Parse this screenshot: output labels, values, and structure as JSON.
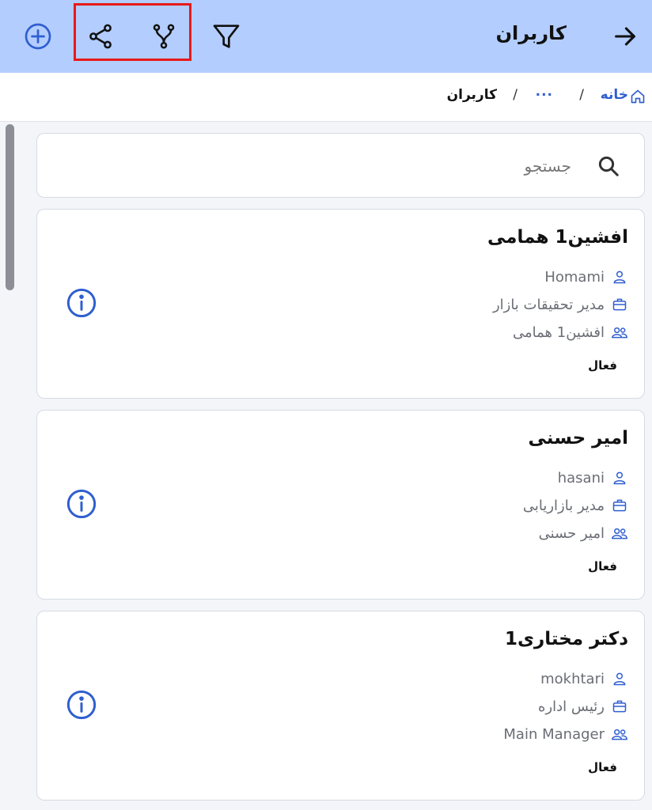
{
  "header": {
    "title": "کاربران",
    "back_icon": "arrow-right-icon",
    "filter_icon": "filter-icon",
    "fork_icon": "fork-icon",
    "share_icon": "share-icon",
    "add_icon": "plus-circle-icon",
    "bg_color": "#b3cdfe",
    "highlight_color": "#e8191a"
  },
  "breadcrumb": {
    "home": "خانه",
    "separator": "/",
    "more": "...",
    "current": "کاربران"
  },
  "search": {
    "placeholder": "جستجو"
  },
  "users": [
    {
      "name": "افشین1 همامی",
      "username": "Homami",
      "job_title": "مدیر تحقیقات بازار",
      "group": "افشین1 همامی",
      "status": "فعال"
    },
    {
      "name": "امیر حسنی",
      "username": "hasani",
      "job_title": "مدیر بازاریابی",
      "group": "امیر حسنی",
      "status": "فعال"
    },
    {
      "name": "دکتر مختاری1",
      "username": "mokhtari",
      "job_title": "رئیس اداره",
      "group": "Main Manager",
      "status": "فعال"
    }
  ],
  "accent_color": "#2f5fcf"
}
